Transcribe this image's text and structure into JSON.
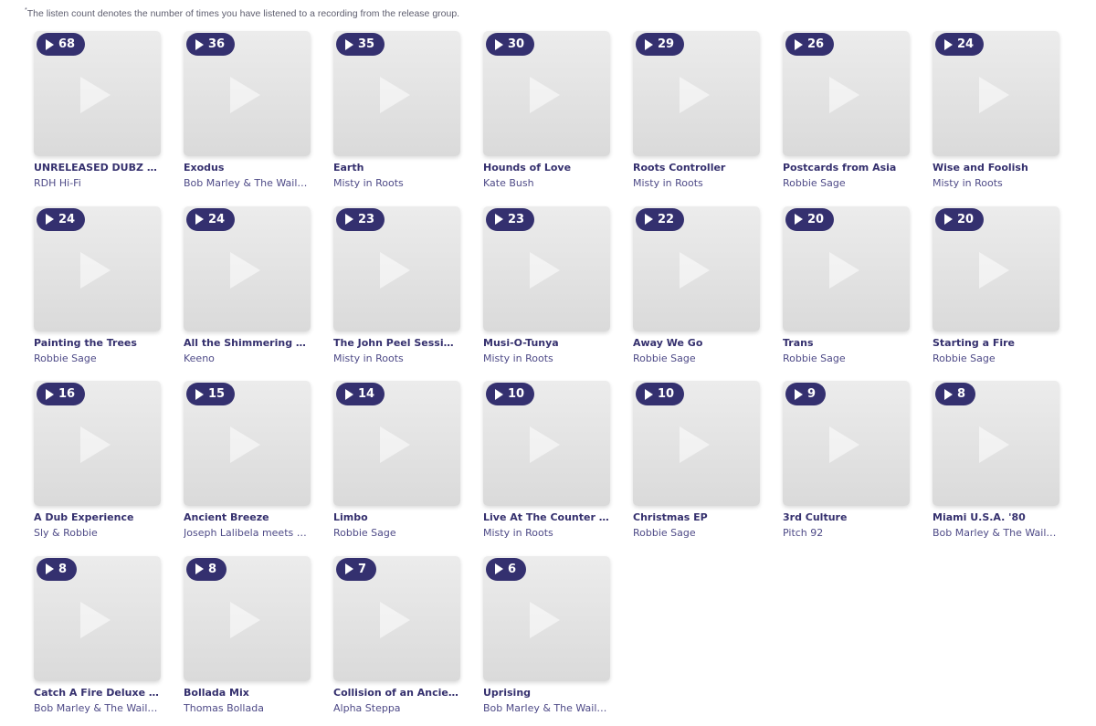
{
  "footnote": {
    "marker": "*",
    "text": "The listen count denotes the number of times you have listened to a recording from the release group."
  },
  "releases": [
    {
      "count": "68",
      "title": "UNRELEASED DUBZ 20…",
      "artist": "RDH Hi-Fi"
    },
    {
      "count": "36",
      "title": "Exodus",
      "artist": "Bob Marley & The Waile…"
    },
    {
      "count": "35",
      "title": "Earth",
      "artist": "Misty in Roots"
    },
    {
      "count": "30",
      "title": "Hounds of Love",
      "artist": "Kate Bush"
    },
    {
      "count": "29",
      "title": "Roots Controller",
      "artist": "Misty in Roots"
    },
    {
      "count": "26",
      "title": "Postcards from Asia",
      "artist": "Robbie Sage"
    },
    {
      "count": "24",
      "title": "Wise and Foolish",
      "artist": "Misty in Roots"
    },
    {
      "count": "24",
      "title": "Painting the Trees",
      "artist": "Robbie Sage"
    },
    {
      "count": "24",
      "title": "All the Shimmering Th…",
      "artist": "Keeno"
    },
    {
      "count": "23",
      "title": "The John Peel Sessions",
      "artist": "Misty in Roots"
    },
    {
      "count": "23",
      "title": "Musi-O-Tunya",
      "artist": "Misty in Roots"
    },
    {
      "count": "22",
      "title": "Away We Go",
      "artist": "Robbie Sage"
    },
    {
      "count": "20",
      "title": "Trans",
      "artist": "Robbie Sage"
    },
    {
      "count": "20",
      "title": "Starting a Fire",
      "artist": "Robbie Sage"
    },
    {
      "count": "16",
      "title": "A Dub Experience",
      "artist": "Sly & Robbie"
    },
    {
      "count": "15",
      "title": "Ancient Breeze",
      "artist": "Joseph Lalibela meets …"
    },
    {
      "count": "14",
      "title": "Limbo",
      "artist": "Robbie Sage"
    },
    {
      "count": "10",
      "title": "Live At The Counter Eu…",
      "artist": "Misty in Roots"
    },
    {
      "count": "10",
      "title": "Christmas EP",
      "artist": "Robbie Sage"
    },
    {
      "count": "9",
      "title": "3rd Culture",
      "artist": "Pitch 92"
    },
    {
      "count": "8",
      "title": "Miami U.S.A. '80",
      "artist": "Bob Marley & The Waile…"
    },
    {
      "count": "8",
      "title": "Catch A Fire Deluxe Ed…",
      "artist": "Bob Marley & The Waile…"
    },
    {
      "count": "8",
      "title": "Bollada Mix",
      "artist": "Thomas Bollada"
    },
    {
      "count": "7",
      "title": "Collision of an Ancien…",
      "artist": "Alpha Steppa"
    },
    {
      "count": "6",
      "title": "Uprising",
      "artist": "Bob Marley & The Waile…"
    }
  ],
  "colors": {
    "badge": "#34306f",
    "title": "#35306e",
    "artist": "#4e4a87"
  }
}
